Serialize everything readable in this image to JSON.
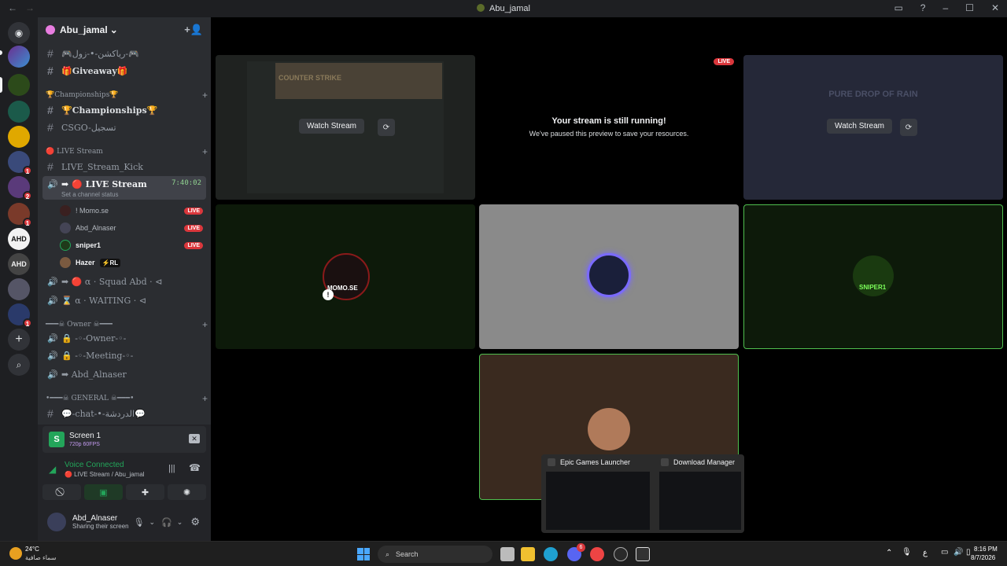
{
  "window": {
    "title": "Abu_jamal"
  },
  "server": {
    "name": "Abu_jamal"
  },
  "channels": {
    "ch1": "🎮رياكشن-•-زول-🎮",
    "giveaway": "🎁Giveaway🎁",
    "cat_championships": "🏆Championships🏆",
    "championships": "🏆Championships🏆",
    "csgo": "CSGO-تسجيل",
    "cat_live": "🔴 LIVE Stream",
    "live_kick": "LIVE_Stream_Kick",
    "live_stream": "➡ 🔴 LIVE Stream",
    "live_time": "7:40:02",
    "live_status": "Set a channel status",
    "squad": "➡ 🔴 α · Squad Abd · ⊲",
    "waiting": "⌛ α · WAITING · ⊲",
    "cat_owner": "━━━☠ Owner ☠━━━",
    "owner": "🔒 -◦-Owner-◦-",
    "meeting": "🔒 -◦-Meeting-◦-",
    "abd": "➡ Abd_Alnaser",
    "cat_general": "•━━━☠ GENERAL ☠━━━•",
    "chat": "💬-chat-•-الدردشة💬"
  },
  "members": [
    {
      "name": "! Momo.se",
      "live": "LIVE"
    },
    {
      "name": "Abd_Alnaser",
      "live": "LIVE"
    },
    {
      "name": "sniper1",
      "live": "LIVE"
    },
    {
      "name": "Hazer",
      "live": "⚡RL"
    }
  ],
  "server_badges": [
    "1",
    "2",
    "1",
    "1"
  ],
  "panel": {
    "screen_title": "Screen 1",
    "screen_sub": "720p 60FPS",
    "voice_connected": "Voice Connected",
    "voice_channel": "🔴 LIVE Stream / Abu_jamal",
    "user_name": "Abd_Alnaser",
    "user_status": "Sharing their screen"
  },
  "stage": {
    "watch_stream": "Watch Stream",
    "live": "LIVE",
    "running_title": "Your stream is still running!",
    "running_sub": "We've paused this preview to save your resources.",
    "cs_text": "COUNTER STRIKE",
    "rain_text": "PURE DROP OF RAIN",
    "momo_label": "MOMO.SE",
    "sniper_label": "SNIPER1"
  },
  "preview": {
    "epic": "Epic Games Launcher",
    "download": "Download Manager"
  },
  "taskbar": {
    "weather_temp": "24°C",
    "weather_desc": "سماء صافية",
    "search": "Search",
    "lang": "ع",
    "time": "8:16 PM",
    "date": "8/7/2026",
    "discord_badge": "6"
  },
  "colors": {
    "discord_bg": "#2b2d31",
    "live_red": "#da373c",
    "voice_green": "#23a55a"
  }
}
